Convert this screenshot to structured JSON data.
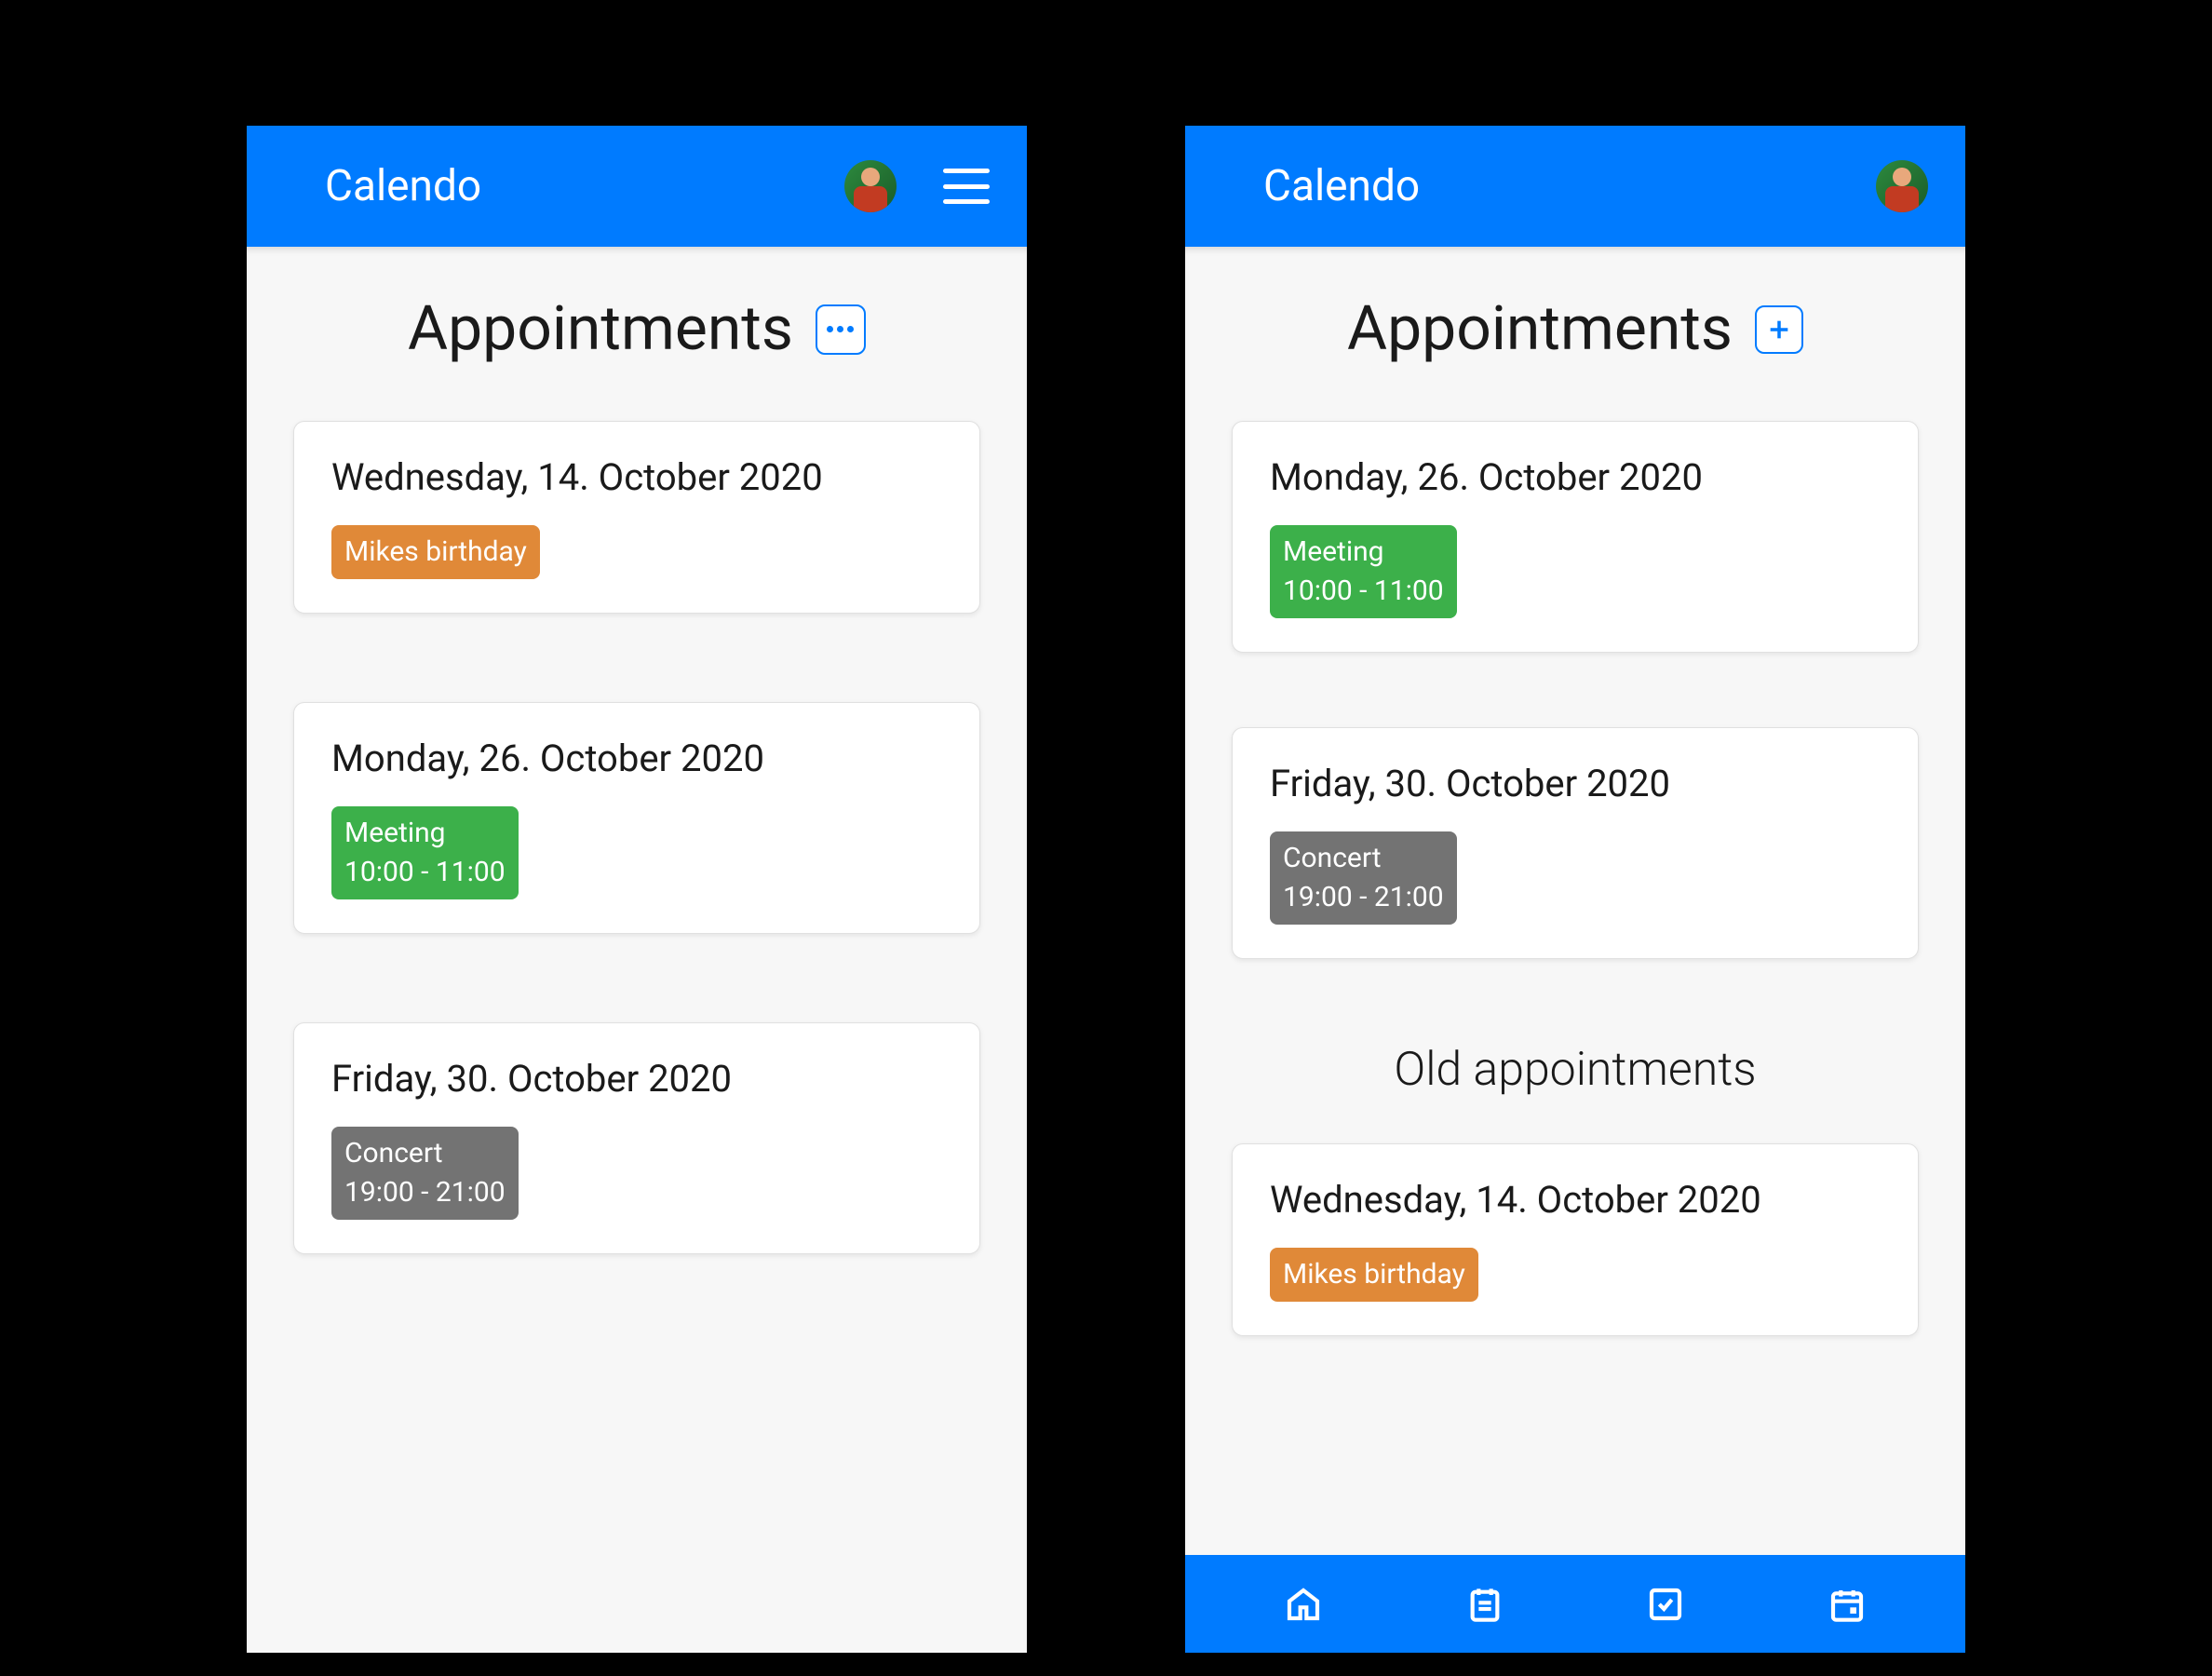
{
  "app": {
    "title": "Calendo"
  },
  "left": {
    "pageTitle": "Appointments",
    "cards": [
      {
        "date": "Wednesday, 14. October 2020",
        "tag": {
          "title": "Mikes birthday",
          "time": "",
          "color": "orange"
        }
      },
      {
        "date": "Monday, 26. October 2020",
        "tag": {
          "title": "Meeting",
          "time": "10:00 - 11:00",
          "color": "green"
        }
      },
      {
        "date": "Friday, 30. October 2020",
        "tag": {
          "title": "Concert",
          "time": "19:00 - 21:00",
          "color": "gray"
        }
      }
    ]
  },
  "right": {
    "pageTitle": "Appointments",
    "sectionTitle": "Old appointments",
    "cards": [
      {
        "date": "Monday, 26. October 2020",
        "tag": {
          "title": "Meeting",
          "time": "10:00 - 11:00",
          "color": "green"
        }
      },
      {
        "date": "Friday, 30. October 2020",
        "tag": {
          "title": "Concert",
          "time": "19:00 - 21:00",
          "color": "gray"
        }
      }
    ],
    "oldCards": [
      {
        "date": "Wednesday, 14. October 2020",
        "tag": {
          "title": "Mikes birthday",
          "time": "",
          "color": "orange"
        }
      }
    ]
  }
}
